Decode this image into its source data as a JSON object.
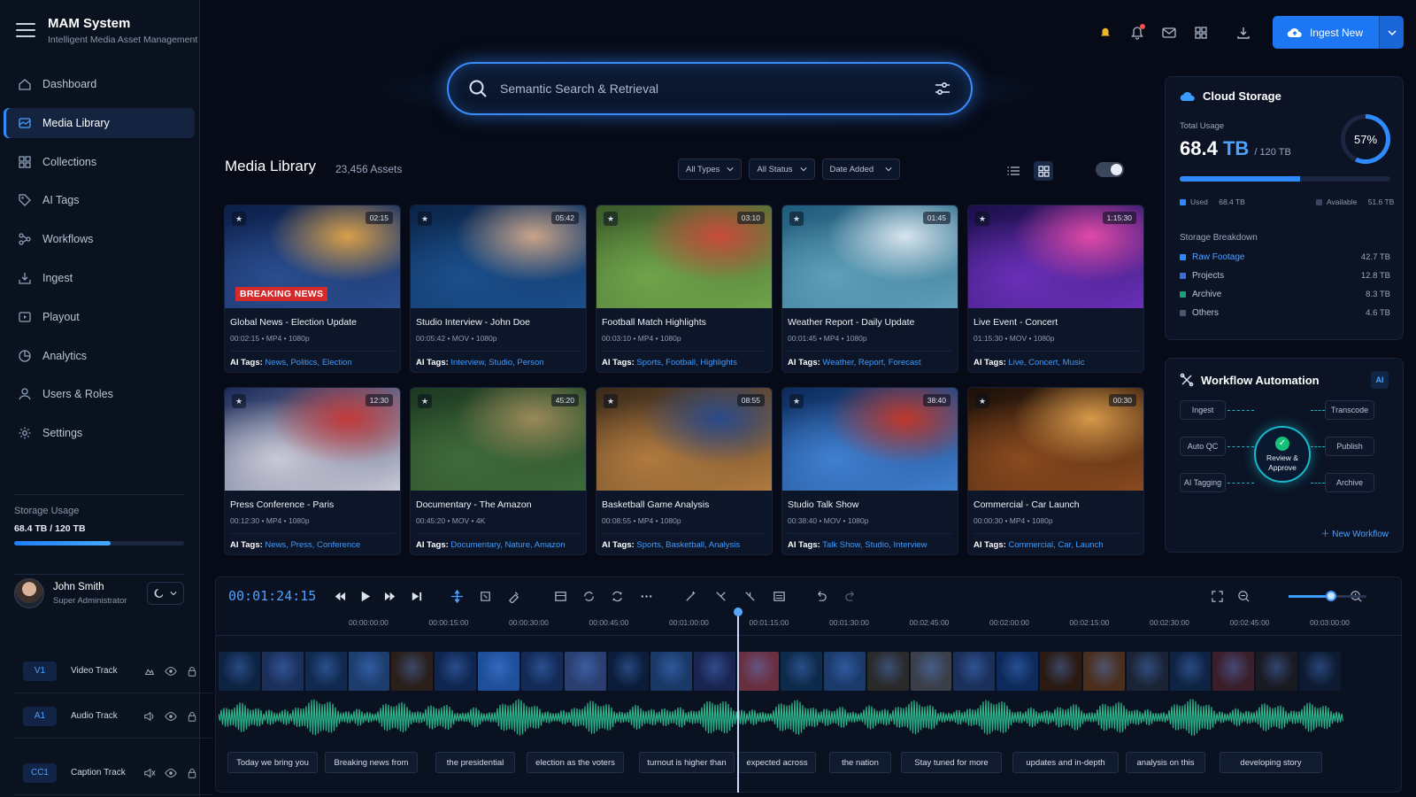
{
  "app": {
    "title": "MAM System",
    "subtitle": "Intelligent Media Asset Management"
  },
  "sidebar": {
    "items": [
      {
        "label": "Dashboard",
        "icon": "home-icon",
        "active": false
      },
      {
        "label": "Media Library",
        "icon": "media-library-icon",
        "active": true
      },
      {
        "label": "Collections",
        "icon": "collections-icon",
        "active": false
      },
      {
        "label": "AI Tags",
        "icon": "tag-icon",
        "active": false
      },
      {
        "label": "Workflows",
        "icon": "workflow-icon",
        "active": false
      },
      {
        "label": "Ingest",
        "icon": "ingest-icon",
        "active": false
      },
      {
        "label": "Playout",
        "icon": "playout-icon",
        "active": false
      },
      {
        "label": "Analytics",
        "icon": "analytics-icon",
        "active": false
      },
      {
        "label": "Users & Roles",
        "icon": "users-icon",
        "active": false
      },
      {
        "label": "Settings",
        "icon": "gear-icon",
        "active": false
      }
    ],
    "storage": {
      "label": "Storage Usage",
      "value": "68.4 TB / 120 TB",
      "fraction": 0.57
    },
    "user": {
      "name": "John Smith",
      "role": "Super Administrator"
    }
  },
  "topbar": {
    "ingest_label": "Ingest New"
  },
  "search": {
    "placeholder": "Semantic Search & Retrieval"
  },
  "library": {
    "title": "Media Library",
    "count": "23,456 Assets",
    "filters": [
      "All Types",
      "All Status",
      "Date Added"
    ],
    "tags_label": "AI Tags:",
    "assets": [
      {
        "title": "Global News - Election Update",
        "duration": "02:15",
        "meta": "00:02:15  •  MP4  •  1080p",
        "tags": "News, Politics, Election",
        "breaking": "BREAKING NEWS",
        "colors": [
          "#0c1f4a",
          "#2a4d8f",
          "#d8a04a"
        ]
      },
      {
        "title": "Studio Interview - John Doe",
        "duration": "05:42",
        "meta": "00:05:42  •  MOV  •  1080p",
        "tags": "Interview, Studio, Person",
        "colors": [
          "#0b2448",
          "#1b4f8c",
          "#c9a58a"
        ]
      },
      {
        "title": "Football Match Highlights",
        "duration": "03:10",
        "meta": "00:03:10  •  MP4  •  1080p",
        "tags": "Sports, Football, Highlights",
        "colors": [
          "#3b5a2a",
          "#6fa34a",
          "#c94b3b"
        ]
      },
      {
        "title": "Weather Report - Daily Update",
        "duration": "01:45",
        "meta": "00:01:45  •  MP4  •  1080p",
        "tags": "Weather, Report, Forecast",
        "colors": [
          "#1f5a7a",
          "#5f9fb8",
          "#d7e5ee"
        ]
      },
      {
        "title": "Live Event - Concert",
        "duration": "1:15:30",
        "meta": "01:15:30  •  MOV  •  1080p",
        "tags": "Live, Concert, Music",
        "colors": [
          "#1a0f4a",
          "#6a2fb8",
          "#e24aa8"
        ]
      },
      {
        "title": "Press Conference - Paris",
        "duration": "12:30",
        "meta": "00:12:30  •  MP4  •  1080p",
        "tags": "News, Press, Conference",
        "colors": [
          "#1a2a5a",
          "#c9c9d6",
          "#c23a3a"
        ]
      },
      {
        "title": "Documentary - The Amazon",
        "duration": "45:20",
        "meta": "00:45:20  •  MOV  •  4K",
        "tags": "Documentary, Nature, Amazon",
        "colors": [
          "#1e3a22",
          "#3f6b3a",
          "#9a8a5a"
        ]
      },
      {
        "title": "Basketball Game Analysis",
        "duration": "08:55",
        "meta": "00:08:55  •  MP4  •  1080p",
        "tags": "Sports, Basketball, Analysis",
        "colors": [
          "#3a2a1a",
          "#b07a3f",
          "#2a4a8a"
        ]
      },
      {
        "title": "Studio Talk Show",
        "duration": "38:40",
        "meta": "00:38:40  •  MOV  •  1080p",
        "tags": "Talk Show, Studio, Interview",
        "colors": [
          "#0c2a5a",
          "#3f7fd0",
          "#c0392b"
        ]
      },
      {
        "title": "Commercial - Car Launch",
        "duration": "00:30",
        "meta": "00:00:30  •  MP4  •  1080p",
        "tags": "Commercial, Car, Launch",
        "colors": [
          "#1a0f08",
          "#8a4a1f",
          "#d89a4a"
        ]
      }
    ]
  },
  "cloud_storage": {
    "title": "Cloud Storage",
    "total_label": "Total Usage",
    "total_value": "68.4",
    "total_unit": "TB",
    "total_of": "/ 120 TB",
    "percent_label": "57%",
    "fraction": 0.57,
    "used_label": "Used",
    "used_value": "68.4 TB",
    "available_label": "Available",
    "available_value": "51.6 TB",
    "breakdown_title": "Storage Breakdown",
    "breakdown": [
      {
        "name": "Raw Footage",
        "value": "42.7 TB",
        "color": "#2d8bff",
        "link": true
      },
      {
        "name": "Projects",
        "value": "12.8 TB",
        "color": "#3b6fd6",
        "link": false
      },
      {
        "name": "Archive",
        "value": "8.3 TB",
        "color": "#1f9e7a",
        "link": false
      },
      {
        "name": "Others",
        "value": "4.6 TB",
        "color": "#4a5670",
        "link": false
      }
    ]
  },
  "workflow": {
    "title": "Workflow Automation",
    "badge": "AI",
    "left": [
      "Ingest",
      "Auto QC",
      "AI Tagging"
    ],
    "right": [
      "Transcode",
      "Publish",
      "Archive"
    ],
    "center": "Review & Approve",
    "new_label": "New Workflow"
  },
  "timeline": {
    "timecode": "00:01:24:15",
    "ticks": [
      "00:00:00:00",
      "00:00:15:00",
      "00:00:30:00",
      "00:00:45:00",
      "00:01:00:00",
      "00:01:15:00",
      "00:01:30:00",
      "00:02:45:00",
      "00:02:00:00",
      "00:02:15:00",
      "00:02:30:00",
      "00:02:45:00",
      "00:03:00:00"
    ],
    "zoom": 0.55,
    "tracks": [
      {
        "id": "V1",
        "name": "Video Track"
      },
      {
        "id": "A1",
        "name": "Audio Track"
      },
      {
        "id": "CC1",
        "name": "Caption Track"
      }
    ],
    "frame_colors": [
      "#0d2342",
      "#1a2f5a",
      "#102a4f",
      "#1c3d6e",
      "#2a1f1a",
      "#0f2650",
      "#1f4f9a",
      "#122a55",
      "#2a3f6f",
      "#0b1d3a",
      "#193866",
      "#1a2450",
      "#6a2f3f",
      "#0e2a4a",
      "#1a3a6a",
      "#2a2a2a",
      "#3a3f4a",
      "#1a2f5a",
      "#0d2a5a",
      "#2a1a12",
      "#4a2f1f",
      "#1a2436",
      "#0f2342",
      "#3a1f2a",
      "#1a1a22",
      "#0d1a30"
    ],
    "captions": [
      "Today we bring you",
      "Breaking news from",
      "the presidential",
      "election as the voters",
      "turnout is higher than",
      "expected across",
      "the nation",
      "Stay tuned for more",
      "updates and in-depth",
      "analysis on this",
      "developing story"
    ]
  }
}
